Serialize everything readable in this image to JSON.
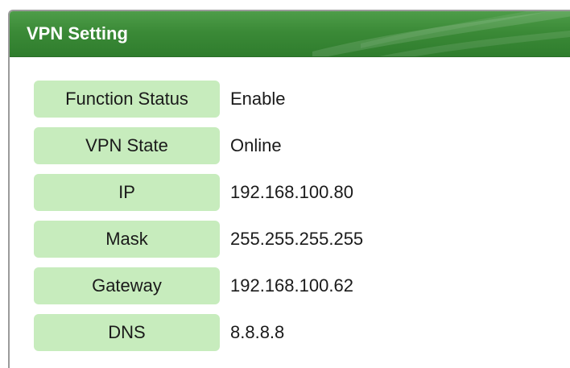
{
  "panel": {
    "title": "VPN Setting",
    "header_color": "#3b8a37",
    "label_bg_color": "#c7ecbd"
  },
  "rows": [
    {
      "label": "Function Status",
      "value": "Enable"
    },
    {
      "label": "VPN State",
      "value": "Online"
    },
    {
      "label": "IP",
      "value": "192.168.100.80"
    },
    {
      "label": "Mask",
      "value": "255.255.255.255"
    },
    {
      "label": "Gateway",
      "value": "192.168.100.62"
    },
    {
      "label": "DNS",
      "value": "8.8.8.8"
    }
  ]
}
